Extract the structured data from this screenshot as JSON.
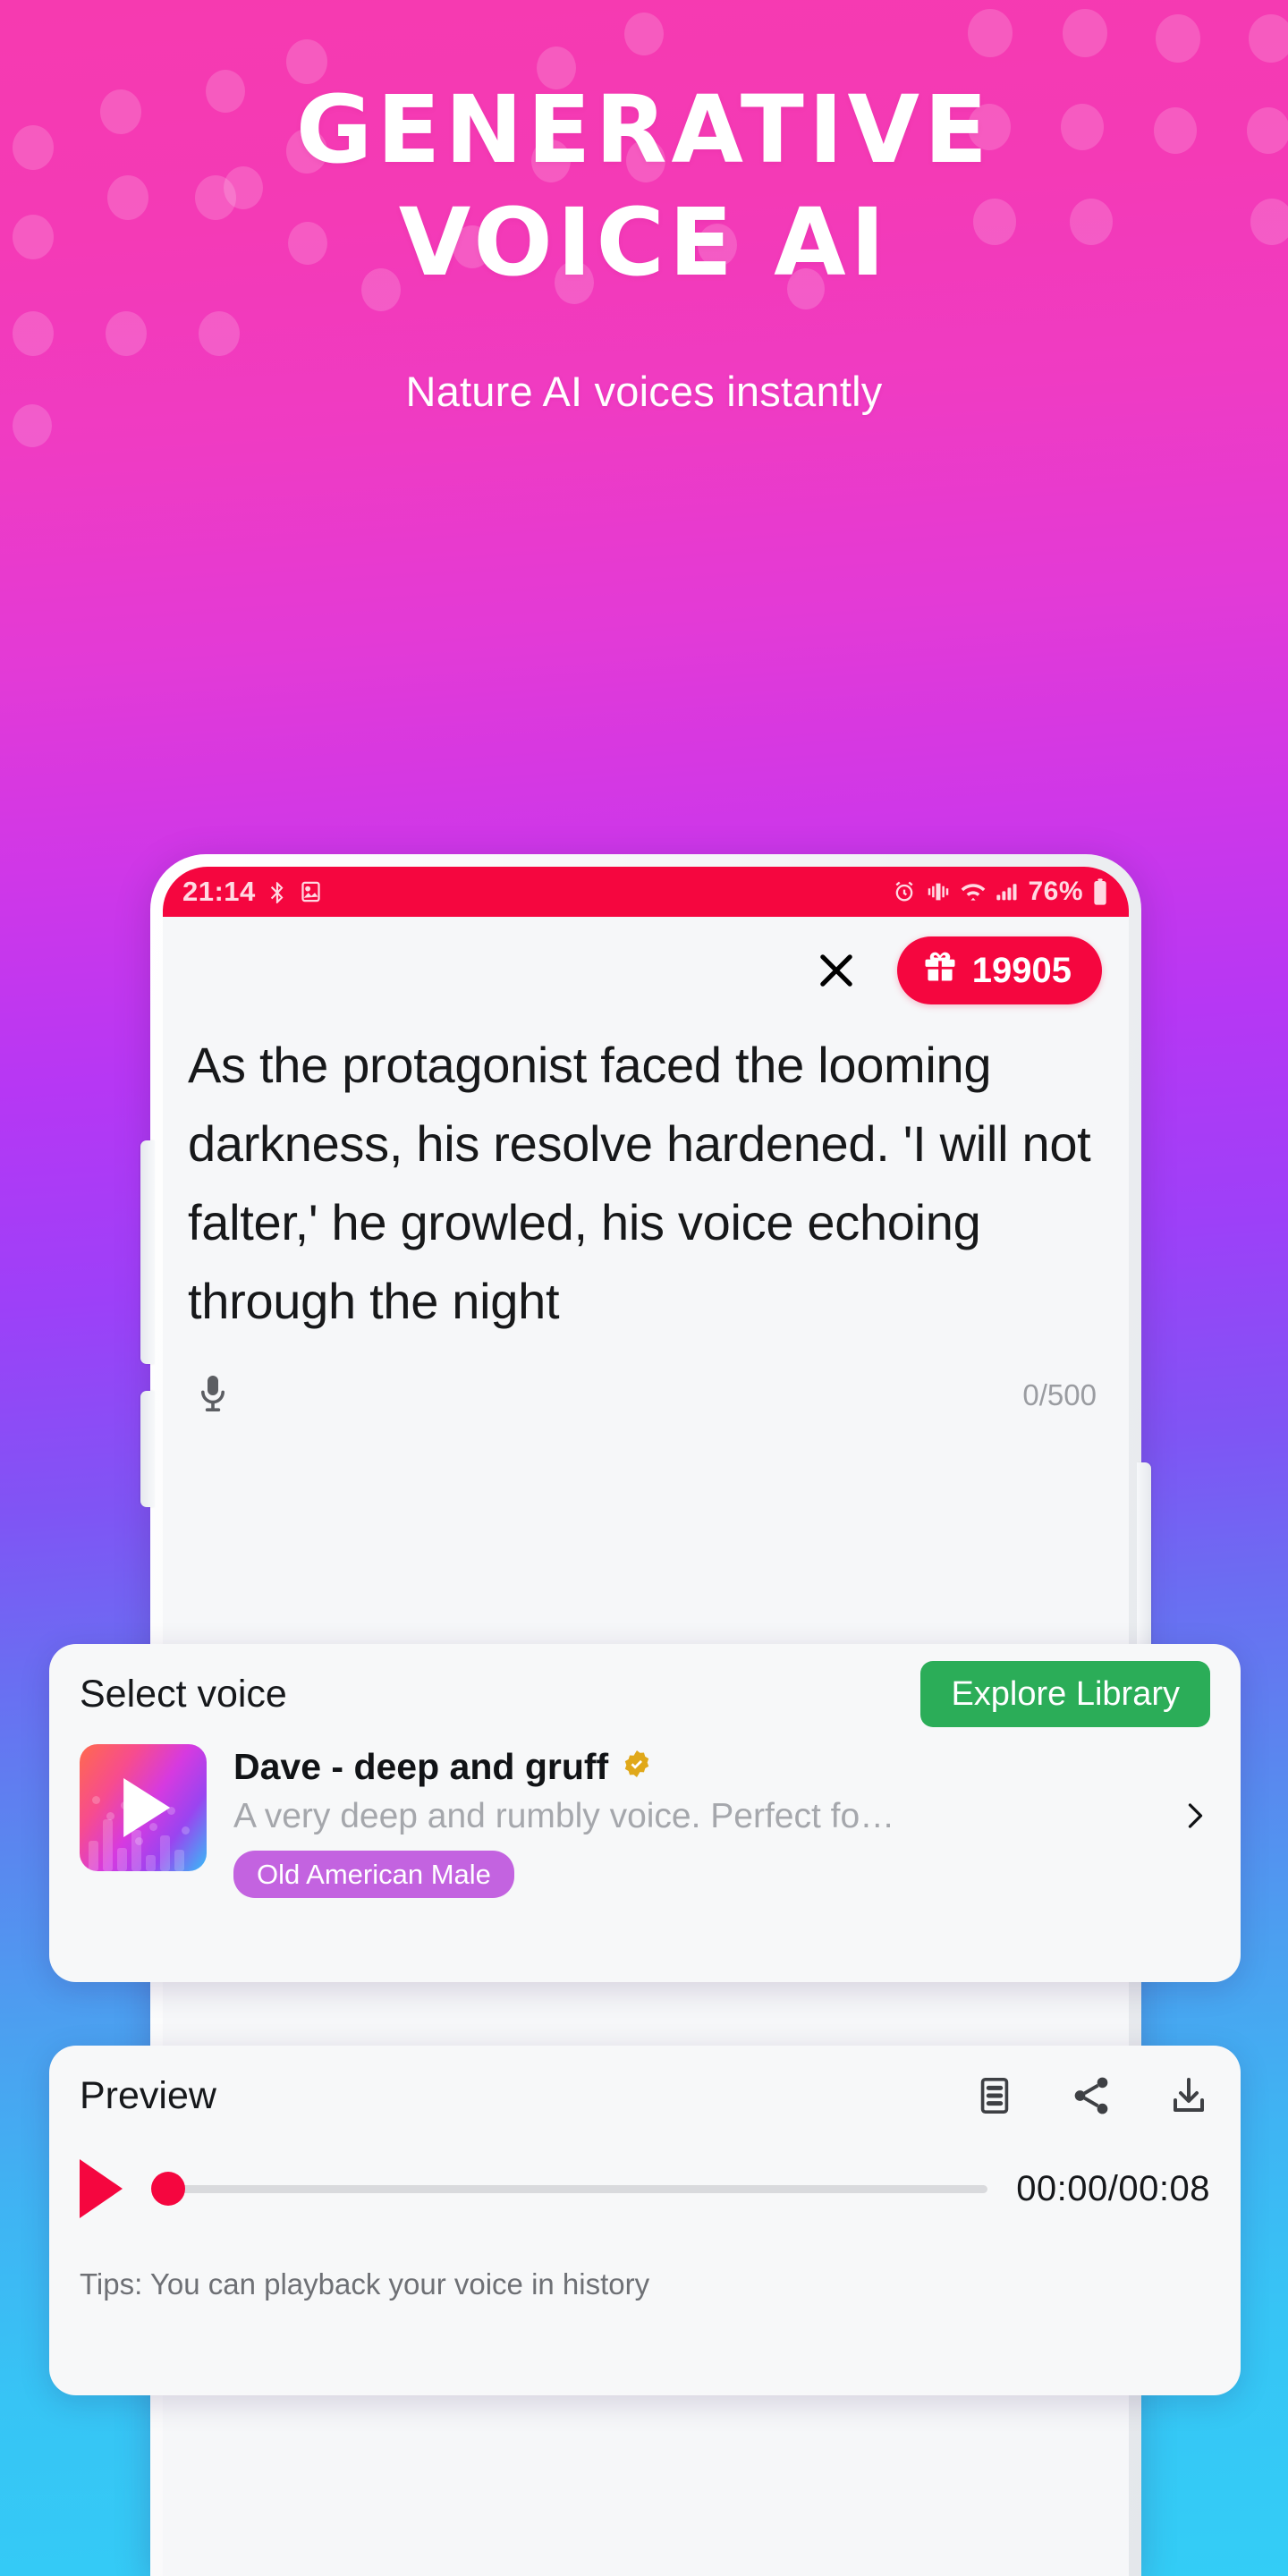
{
  "hero": {
    "title_line1": "GENERATIVE",
    "title_line2": "VOICE AI",
    "subtitle": "Nature AI voices instantly"
  },
  "colors": {
    "bg_top": "#f63ab0",
    "bg_mid": "#9d40f8",
    "bg_bottom": "#33cdf6",
    "accent_red": "#f5063f",
    "accent_green": "#2bad58",
    "tag_purple": "#c363e0",
    "verified_gold": "#e0a81a"
  },
  "status_bar": {
    "time": "21:14",
    "left_icons": [
      "bluetooth-audio-icon",
      "image-icon"
    ],
    "right_icons": [
      "alarm-icon",
      "vibrate-icon",
      "wifi-icon",
      "signal-icon"
    ],
    "battery_percent": "76%",
    "battery_icon": "battery-icon"
  },
  "app_header": {
    "close_icon": "close-icon",
    "gift_icon": "gift-icon",
    "credits": "19905"
  },
  "editor": {
    "text": "As the protagonist faced the looming darkness, his resolve hardened. 'I will not falter,' he growled, his voice echoing through the night",
    "mic_icon": "microphone-icon",
    "counter": "0/500"
  },
  "voice_card": {
    "title": "Select voice",
    "explore_label": "Explore Library",
    "thumbnail_icon": "play-icon",
    "name": "Dave - deep and gruff",
    "verified_icon": "verified-badge-icon",
    "description": "A very deep and rumbly voice. Perfect fo…",
    "tag": "Old American Male",
    "chevron_icon": "chevron-right-icon"
  },
  "preview_card": {
    "title": "Preview",
    "icons": [
      "transcript-icon",
      "share-icon",
      "download-icon"
    ],
    "play_icon": "play-icon",
    "progress_percent": 0,
    "time": "00:00/00:08",
    "tips": "Tips: You can playback your voice in history"
  }
}
